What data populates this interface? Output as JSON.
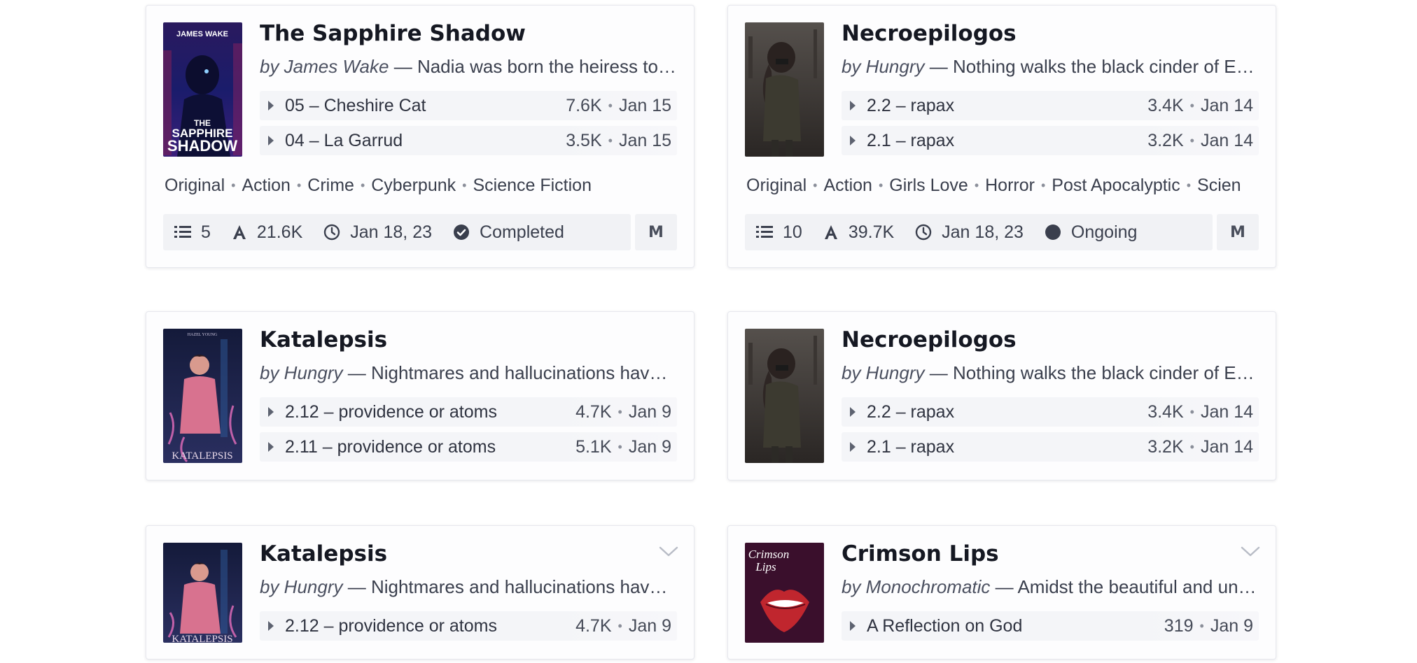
{
  "cards": [
    {
      "title": "The Sapphire Shadow",
      "by": "by James Wake",
      "sep": " — ",
      "desc": "Nadia was born the heiress to a c…",
      "cover_text_top": "JAMES WAKE",
      "cover_text_l1": "THE",
      "cover_text_l2": "SAPPHIRE",
      "cover_text_l3": "SHADOW",
      "chapters": [
        {
          "title": "05 – Cheshire Cat",
          "words": "7.6K",
          "date": "Jan 15"
        },
        {
          "title": "04 – La Garrud",
          "words": "3.5K",
          "date": "Jan 15"
        }
      ],
      "tags": [
        "Original",
        "Action",
        "Crime",
        "Cyberpunk",
        "Science Fiction"
      ],
      "stats": {
        "chapters": "5",
        "words": "21.6K",
        "updated": "Jan 18, 23",
        "status": "Completed"
      },
      "rating": "M"
    },
    {
      "title": "Necroepilogos",
      "by": "by Hungry",
      "sep": " — ",
      "desc": "Nothing walks the black cinder of Ear…",
      "chapters": [
        {
          "title": "2.2 – rapax",
          "words": "3.4K",
          "date": "Jan 14"
        },
        {
          "title": "2.1 – rapax",
          "words": "3.2K",
          "date": "Jan 14"
        }
      ],
      "tags": [
        "Original",
        "Action",
        "Girls Love",
        "Horror",
        "Post Apocalyptic",
        "Scien"
      ],
      "stats": {
        "chapters": "10",
        "words": "39.7K",
        "updated": "Jan 18, 23",
        "status": "Ongoing"
      },
      "rating": "M"
    },
    {
      "title": "Katalepsis",
      "by": "by Hungry",
      "sep": " — ",
      "desc": "Nightmares and hallucinations have p…",
      "cover_text_top": "HAZEL YOUNG",
      "cover_text_bottom": "KATALEPSIS",
      "chapters": [
        {
          "title": "2.12 – providence or atoms",
          "words": "4.7K",
          "date": "Jan 9"
        },
        {
          "title": "2.11 – providence or atoms",
          "words": "5.1K",
          "date": "Jan 9"
        }
      ]
    },
    {
      "title": "Necroepilogos",
      "by": "by Hungry",
      "sep": " — ",
      "desc": "Nothing walks the black cinder of Ear…",
      "chapters": [
        {
          "title": "2.2 – rapax",
          "words": "3.4K",
          "date": "Jan 14"
        },
        {
          "title": "2.1 – rapax",
          "words": "3.2K",
          "date": "Jan 14"
        }
      ]
    },
    {
      "title": "Katalepsis",
      "by": "by Hungry",
      "sep": " — ",
      "desc": "Nightmares and hallucinations have p…",
      "cover_text_bottom": "KATALEPSIS",
      "chapters": [
        {
          "title": "2.12 – providence or atoms",
          "words": "4.7K",
          "date": "Jan 9"
        }
      ]
    },
    {
      "title": "Crimson Lips",
      "by": "by Monochromatic",
      "sep": " — ",
      "desc": "Amidst the beautiful and unf…",
      "cover_text_l1": "Crimson",
      "cover_text_l2": "Lips",
      "chapters": [
        {
          "title": "A Reflection on God",
          "words": "319",
          "date": "Jan 9"
        }
      ]
    }
  ],
  "colors": {
    "sapphire": "#1a1c6b",
    "katalepsis": "#1c2450",
    "necro": "#3a3330",
    "crimson_bg": "#3a0f2c",
    "crimson_lips": "#c0262e"
  }
}
